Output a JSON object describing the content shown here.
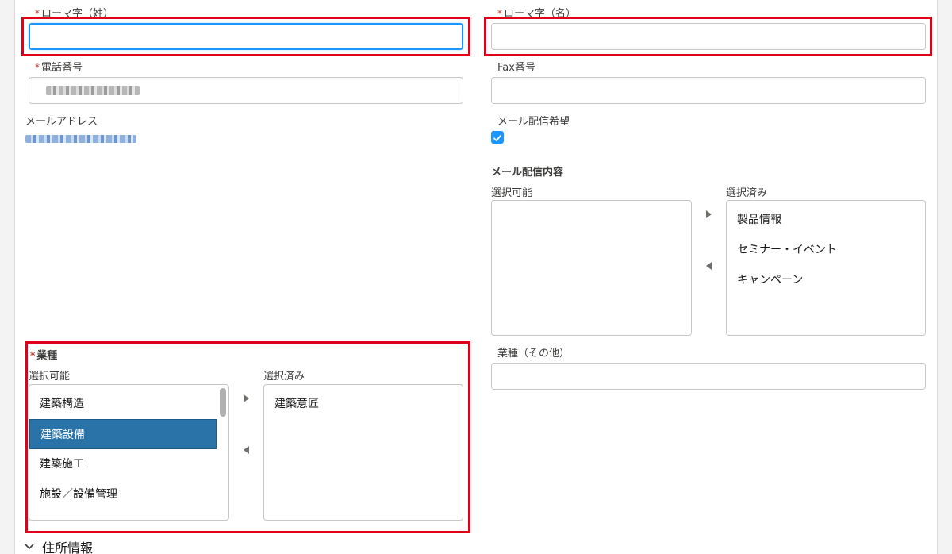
{
  "romaji_last": {
    "label": "ローマ字（姓）",
    "required": "*",
    "value": ""
  },
  "romaji_first": {
    "label": "ローマ字（名）",
    "required": "*",
    "value": ""
  },
  "phone": {
    "label": "電話番号",
    "required": "*"
  },
  "fax": {
    "label": "Fax番号",
    "value": ""
  },
  "email": {
    "label": "メールアドレス"
  },
  "mail_optin": {
    "label": "メール配信希望",
    "checked": true
  },
  "mail_content": {
    "title": "メール配信内容",
    "available_label": "選択可能",
    "selected_label": "選択済み",
    "available": [],
    "selected": [
      "製品情報",
      "セミナー・イベント",
      "キャンペーン"
    ]
  },
  "industry": {
    "title": "業種",
    "required": "*",
    "available_label": "選択可能",
    "selected_label": "選択済み",
    "available": [
      "建築構造",
      "建築設備",
      "建築施工",
      "施設／設備管理"
    ],
    "highlighted": "建築設備",
    "selected": [
      "建築意匠"
    ]
  },
  "industry_other": {
    "label": "業種（その他）",
    "value": ""
  },
  "address_section": {
    "title": "住所情報"
  },
  "colors": {
    "accent": "#1b96ff",
    "selected_option": "#2a73a8",
    "highlight_box": "#e0001a",
    "required": "#c23934"
  }
}
